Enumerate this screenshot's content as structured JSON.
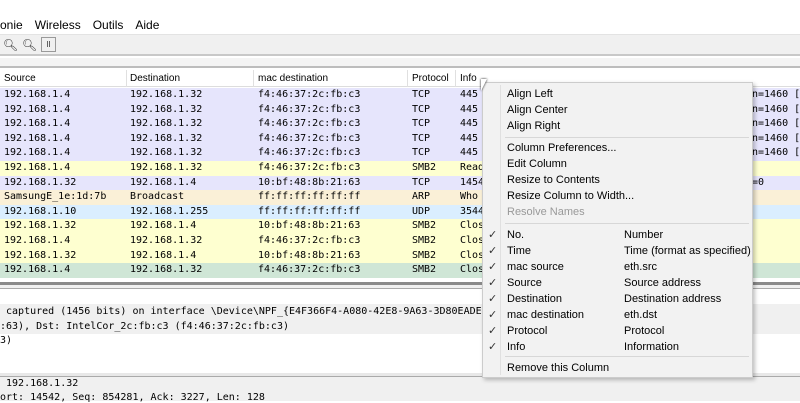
{
  "menubar": [
    "onie",
    "Wireless",
    "Outils",
    "Aide"
  ],
  "toolbar": {
    "icons": [
      "zoom-out-icon",
      "zoom-normal-icon",
      "resize-columns-icon"
    ]
  },
  "columns": [
    "Source",
    "Destination",
    "mac destination",
    "Protocol",
    "Info"
  ],
  "packets": [
    {
      "src": "192.168.1.4",
      "dst": "192.168.1.32",
      "macdst": "f4:46:37:2c:fb:c3",
      "proto": "TCP",
      "info": "445",
      "tail": "n=1460 [",
      "color": "#e6e5fc"
    },
    {
      "src": "192.168.1.4",
      "dst": "192.168.1.32",
      "macdst": "f4:46:37:2c:fb:c3",
      "proto": "TCP",
      "info": "445",
      "tail": "n=1460 [",
      "color": "#e6e5fc"
    },
    {
      "src": "192.168.1.4",
      "dst": "192.168.1.32",
      "macdst": "f4:46:37:2c:fb:c3",
      "proto": "TCP",
      "info": "445",
      "tail": "n=1460 [",
      "color": "#e6e5fc"
    },
    {
      "src": "192.168.1.4",
      "dst": "192.168.1.32",
      "macdst": "f4:46:37:2c:fb:c3",
      "proto": "TCP",
      "info": "445",
      "tail": "n=1460 [",
      "color": "#e6e5fc"
    },
    {
      "src": "192.168.1.4",
      "dst": "192.168.1.32",
      "macdst": "f4:46:37:2c:fb:c3",
      "proto": "TCP",
      "info": "445",
      "tail": "n=1460 [",
      "color": "#e6e5fc"
    },
    {
      "src": "192.168.1.4",
      "dst": "192.168.1.32",
      "macdst": "f4:46:37:2c:fb:c3",
      "proto": "SMB2",
      "info": "Read",
      "tail": "",
      "color": "#feffd0"
    },
    {
      "src": "192.168.1.32",
      "dst": "192.168.1.4",
      "macdst": "10:bf:48:8b:21:63",
      "proto": "TCP",
      "info": "1454",
      "tail": "=0",
      "color": "#e6e5fc"
    },
    {
      "src": "SamsungE_1e:1d:7b",
      "dst": "Broadcast",
      "macdst": "ff:ff:ff:ff:ff:ff",
      "proto": "ARP",
      "info": "Who",
      "tail": "",
      "color": "#faf0d7"
    },
    {
      "src": "192.168.1.10",
      "dst": "192.168.1.255",
      "macdst": "ff:ff:ff:ff:ff:ff",
      "proto": "UDP",
      "info": "3544",
      "tail": "",
      "color": "#daeeff"
    },
    {
      "src": "192.168.1.32",
      "dst": "192.168.1.4",
      "macdst": "10:bf:48:8b:21:63",
      "proto": "SMB2",
      "info": "Clos",
      "tail": "",
      "color": "#feffd0"
    },
    {
      "src": "192.168.1.4",
      "dst": "192.168.1.32",
      "macdst": "f4:46:37:2c:fb:c3",
      "proto": "SMB2",
      "info": "Clos",
      "tail": "",
      "color": "#feffd0"
    },
    {
      "src": "192.168.1.32",
      "dst": "192.168.1.4",
      "macdst": "10:bf:48:8b:21:63",
      "proto": "SMB2",
      "info": "Clos",
      "tail": "",
      "color": "#feffd0"
    },
    {
      "src": "192.168.1.4",
      "dst": "192.168.1.32",
      "macdst": "f4:46:37:2c:fb:c3",
      "proto": "SMB2",
      "info": "Clos",
      "tail": "",
      "color": "#cfe6d6"
    }
  ],
  "details": [
    " captured (1456 bits) on interface \\Device\\NPF_{E4F366F4-A080-42E8-9A63-3D80EADE",
    ":63), Dst: IntelCor_2c:fb:c3 (f4:46:37:2c:fb:c3)",
    "3)"
  ],
  "bytes": [
    " 192.168.1.32",
    "ort: 14542, Seq: 854281, Ack: 3227, Len: 128"
  ],
  "context_menu": {
    "align": [
      "Align Left",
      "Align Center",
      "Align Right"
    ],
    "actions": [
      "Column Preferences...",
      "Edit Column",
      "Resize to Contents",
      "Resize Column to Width..."
    ],
    "disabled": "Resolve Names",
    "columns": [
      {
        "label": "No.",
        "field": "Number",
        "checked": true
      },
      {
        "label": "Time",
        "field": "Time (format as specified)",
        "checked": true
      },
      {
        "label": "mac source",
        "field": "eth.src",
        "checked": true
      },
      {
        "label": "Source",
        "field": "Source address",
        "checked": true
      },
      {
        "label": "Destination",
        "field": "Destination address",
        "checked": true
      },
      {
        "label": "mac destination",
        "field": "eth.dst",
        "checked": true
      },
      {
        "label": "Protocol",
        "field": "Protocol",
        "checked": true
      },
      {
        "label": "Info",
        "field": "Information",
        "checked": true
      }
    ],
    "remove": "Remove this Column",
    "check_glyph": "✓"
  }
}
